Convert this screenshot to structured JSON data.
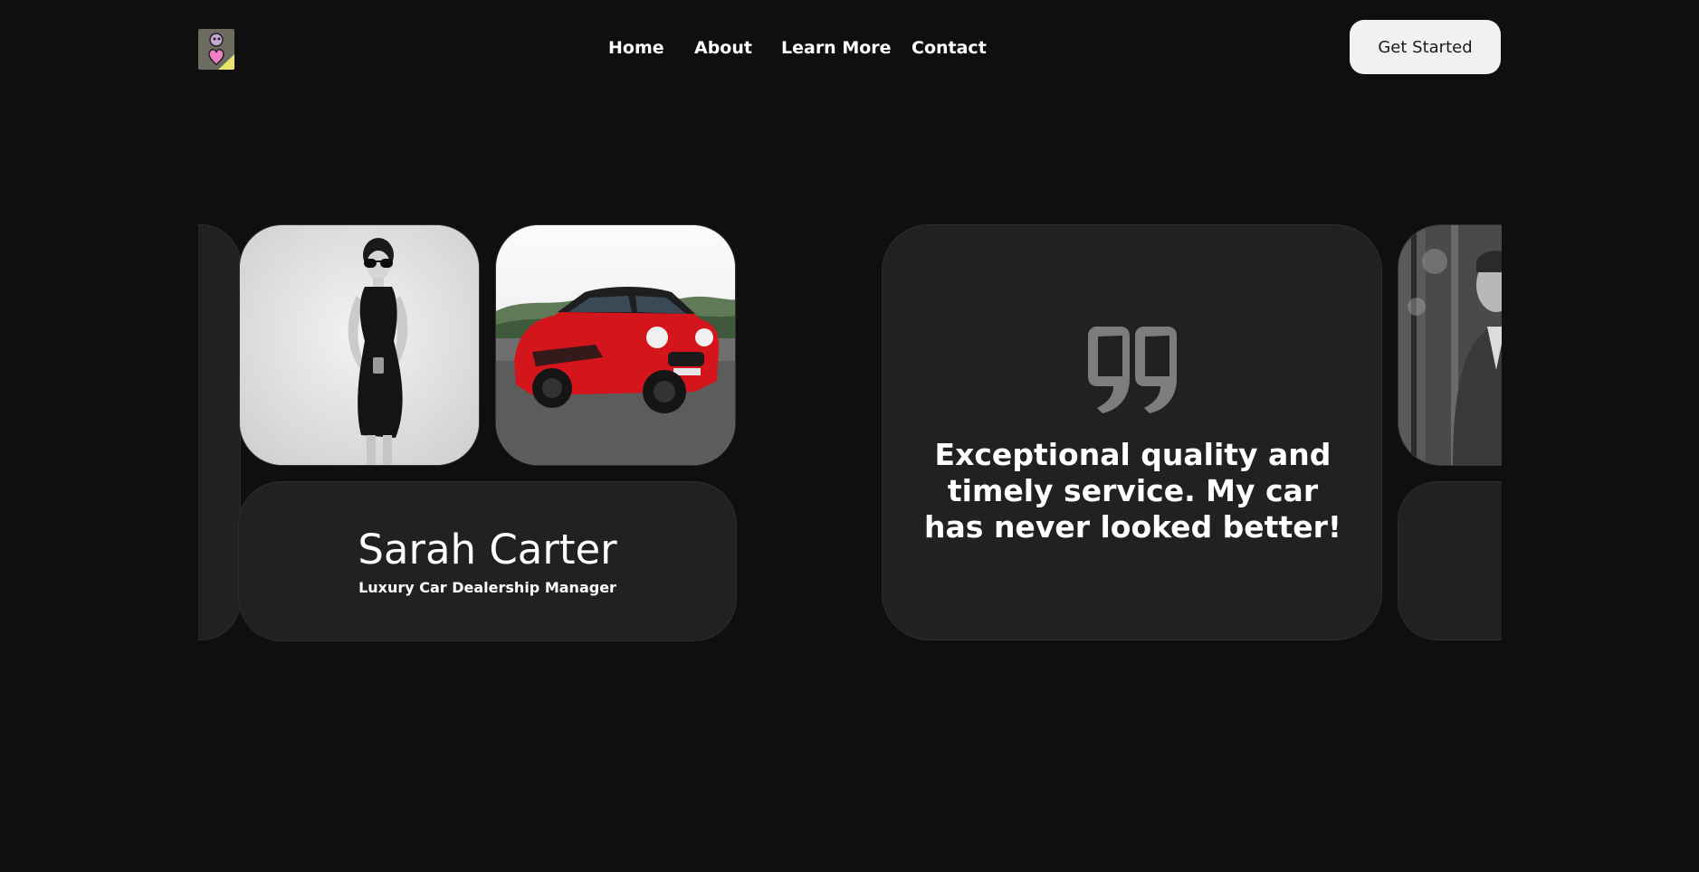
{
  "header": {
    "logo_icon": "heart-cartoon-logo-icon",
    "nav": [
      {
        "label": "Home"
      },
      {
        "label": "About"
      },
      {
        "label": "Learn More"
      },
      {
        "label": "Contact"
      }
    ],
    "cta_label": "Get Started"
  },
  "testimonial": {
    "person_name": "Sarah Carter",
    "person_role": "Luxury Car Dealership Manager",
    "quote_icon": "quote-mark-icon",
    "quote": "Exceptional quality and timely service. My car has never looked better!",
    "photos": [
      {
        "name": "woman-portrait-photo"
      },
      {
        "name": "red-car-photo"
      },
      {
        "name": "man-portrait-photo"
      }
    ]
  },
  "colors": {
    "background": "#0f0f0f",
    "card": "#212121",
    "button_bg": "#f1f1f1",
    "button_text": "#1a1a1a",
    "quote_icon": "#7d7d7d",
    "car_red": "#d4161c"
  }
}
